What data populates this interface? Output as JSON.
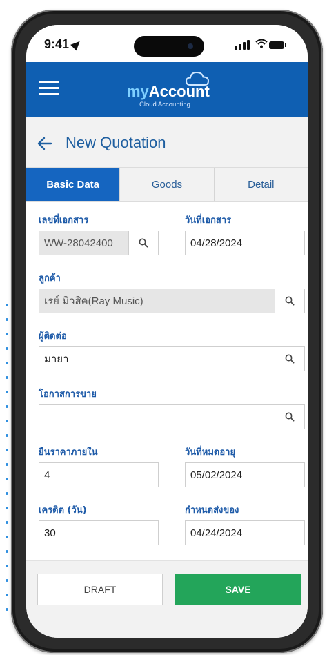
{
  "status_bar": {
    "time": "9:41"
  },
  "app_header": {
    "logo_my": "my",
    "logo_account": "Account",
    "logo_subtitle": "Cloud Accounting"
  },
  "page": {
    "title": "New Quotation"
  },
  "tabs": [
    {
      "label": "Basic Data",
      "active": true
    },
    {
      "label": "Goods",
      "active": false
    },
    {
      "label": "Detail",
      "active": false
    }
  ],
  "form": {
    "doc_number": {
      "label": "เลขที่เอกสาร",
      "value": "WW-28042400"
    },
    "doc_date": {
      "label": "วันที่เอกสาร",
      "value": "04/28/2024"
    },
    "customer": {
      "label": "ลูกค้า",
      "value": "เรย์ มิวสิค(Ray Music)"
    },
    "contact": {
      "label": "ผู้ติดต่อ",
      "value": "มายา"
    },
    "sales_opportunity": {
      "label": "โอกาสการขาย",
      "value": ""
    },
    "price_valid": {
      "label": "ยืนราคาภายใน",
      "value": "4"
    },
    "expiry_date": {
      "label": "วันที่หมดอายุ",
      "value": "05/02/2024"
    },
    "credit_days": {
      "label": "เครดิต (วัน)",
      "value": "30"
    },
    "delivery_date": {
      "label": "กำหนดส่งของ",
      "value": "04/24/2024"
    }
  },
  "footer": {
    "draft_label": "DRAFT",
    "save_label": "SAVE"
  },
  "colors": {
    "header_blue": "#0f5fb2",
    "tab_active": "#1565c0",
    "label_blue": "#1d5aa8",
    "save_green": "#23a55a"
  }
}
